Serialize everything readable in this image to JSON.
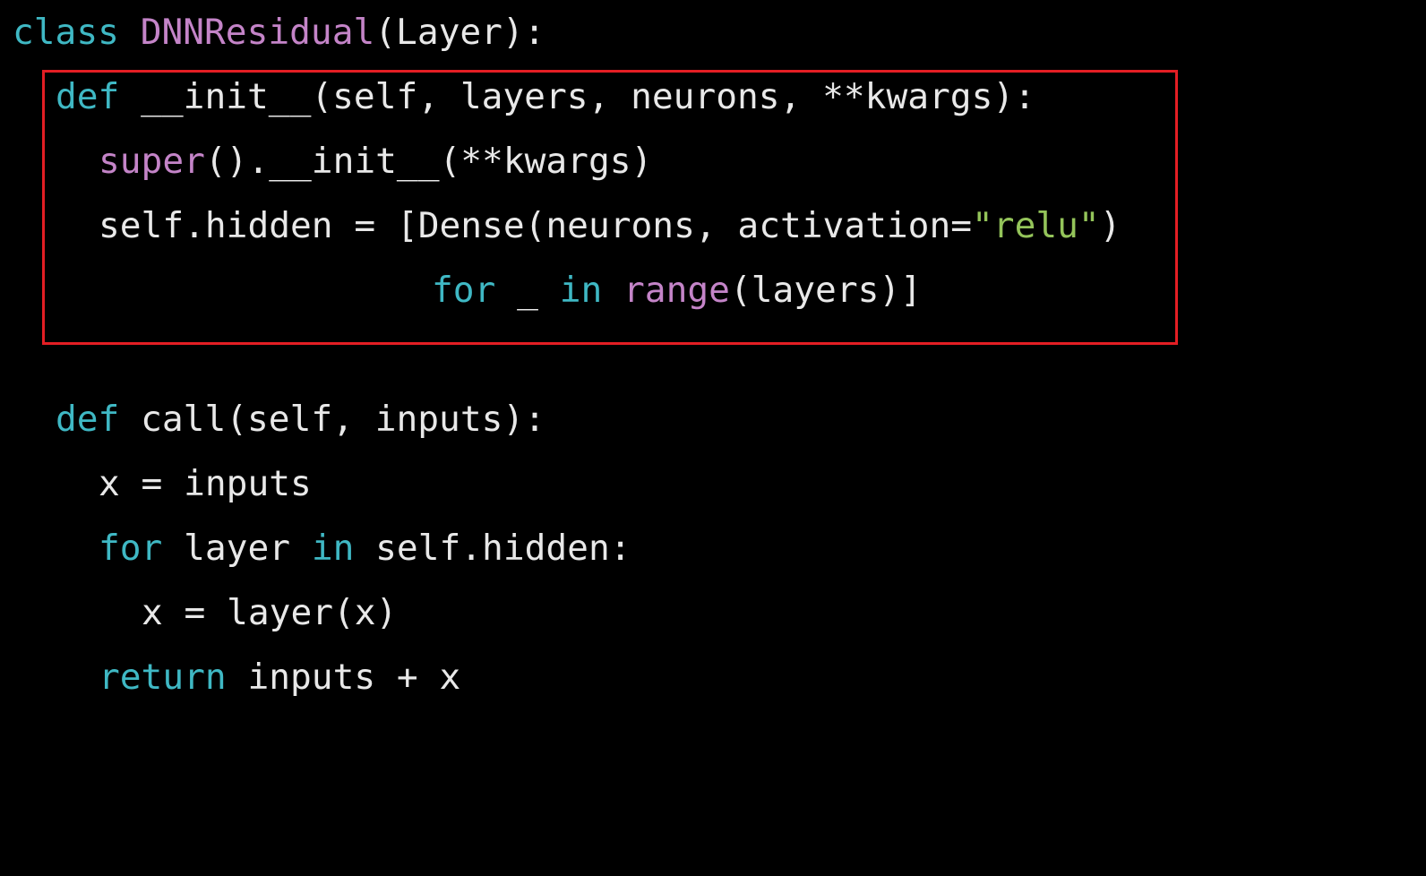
{
  "colors": {
    "background": "#000000",
    "plain": "#e8e8e8",
    "keyword": "#3fb8c4",
    "builtin": "#c484c8",
    "string": "#94c45a",
    "highlight_border": "#e31e24"
  },
  "code": {
    "lines": [
      {
        "tokens": [
          {
            "t": "class",
            "k": "keyword"
          },
          {
            "t": " ",
            "k": "plain"
          },
          {
            "t": "DNNResidual",
            "k": "builtin"
          },
          {
            "t": "(Layer):",
            "k": "plain"
          }
        ]
      },
      {
        "tokens": [
          {
            "t": "def",
            "k": "keyword"
          },
          {
            "t": " __init__(self, layers, neurons, **kwargs):",
            "k": "plain"
          }
        ]
      },
      {
        "tokens": [
          {
            "t": "super",
            "k": "builtin"
          },
          {
            "t": "().__init__(**kwargs)",
            "k": "plain"
          }
        ]
      },
      {
        "tokens": [
          {
            "t": "self.hidden = [Dense(neurons, activation=",
            "k": "plain"
          },
          {
            "t": "\"relu\"",
            "k": "string"
          },
          {
            "t": ")",
            "k": "plain"
          }
        ]
      },
      {
        "tokens": [
          {
            "t": "for",
            "k": "keyword"
          },
          {
            "t": " _ ",
            "k": "plain"
          },
          {
            "t": "in",
            "k": "keyword"
          },
          {
            "t": " ",
            "k": "plain"
          },
          {
            "t": "range",
            "k": "builtin"
          },
          {
            "t": "(layers)]",
            "k": "plain"
          }
        ]
      },
      {
        "tokens": [
          {
            "t": "def",
            "k": "keyword"
          },
          {
            "t": " call(self, inputs):",
            "k": "plain"
          }
        ]
      },
      {
        "tokens": [
          {
            "t": "x = inputs",
            "k": "plain"
          }
        ]
      },
      {
        "tokens": [
          {
            "t": "for",
            "k": "keyword"
          },
          {
            "t": " layer ",
            "k": "plain"
          },
          {
            "t": "in",
            "k": "keyword"
          },
          {
            "t": " self.hidden:",
            "k": "plain"
          }
        ]
      },
      {
        "tokens": [
          {
            "t": "x = layer(x)",
            "k": "plain"
          }
        ]
      },
      {
        "tokens": [
          {
            "t": "return",
            "k": "keyword"
          },
          {
            "t": " inputs + x",
            "k": "plain"
          }
        ]
      }
    ]
  }
}
